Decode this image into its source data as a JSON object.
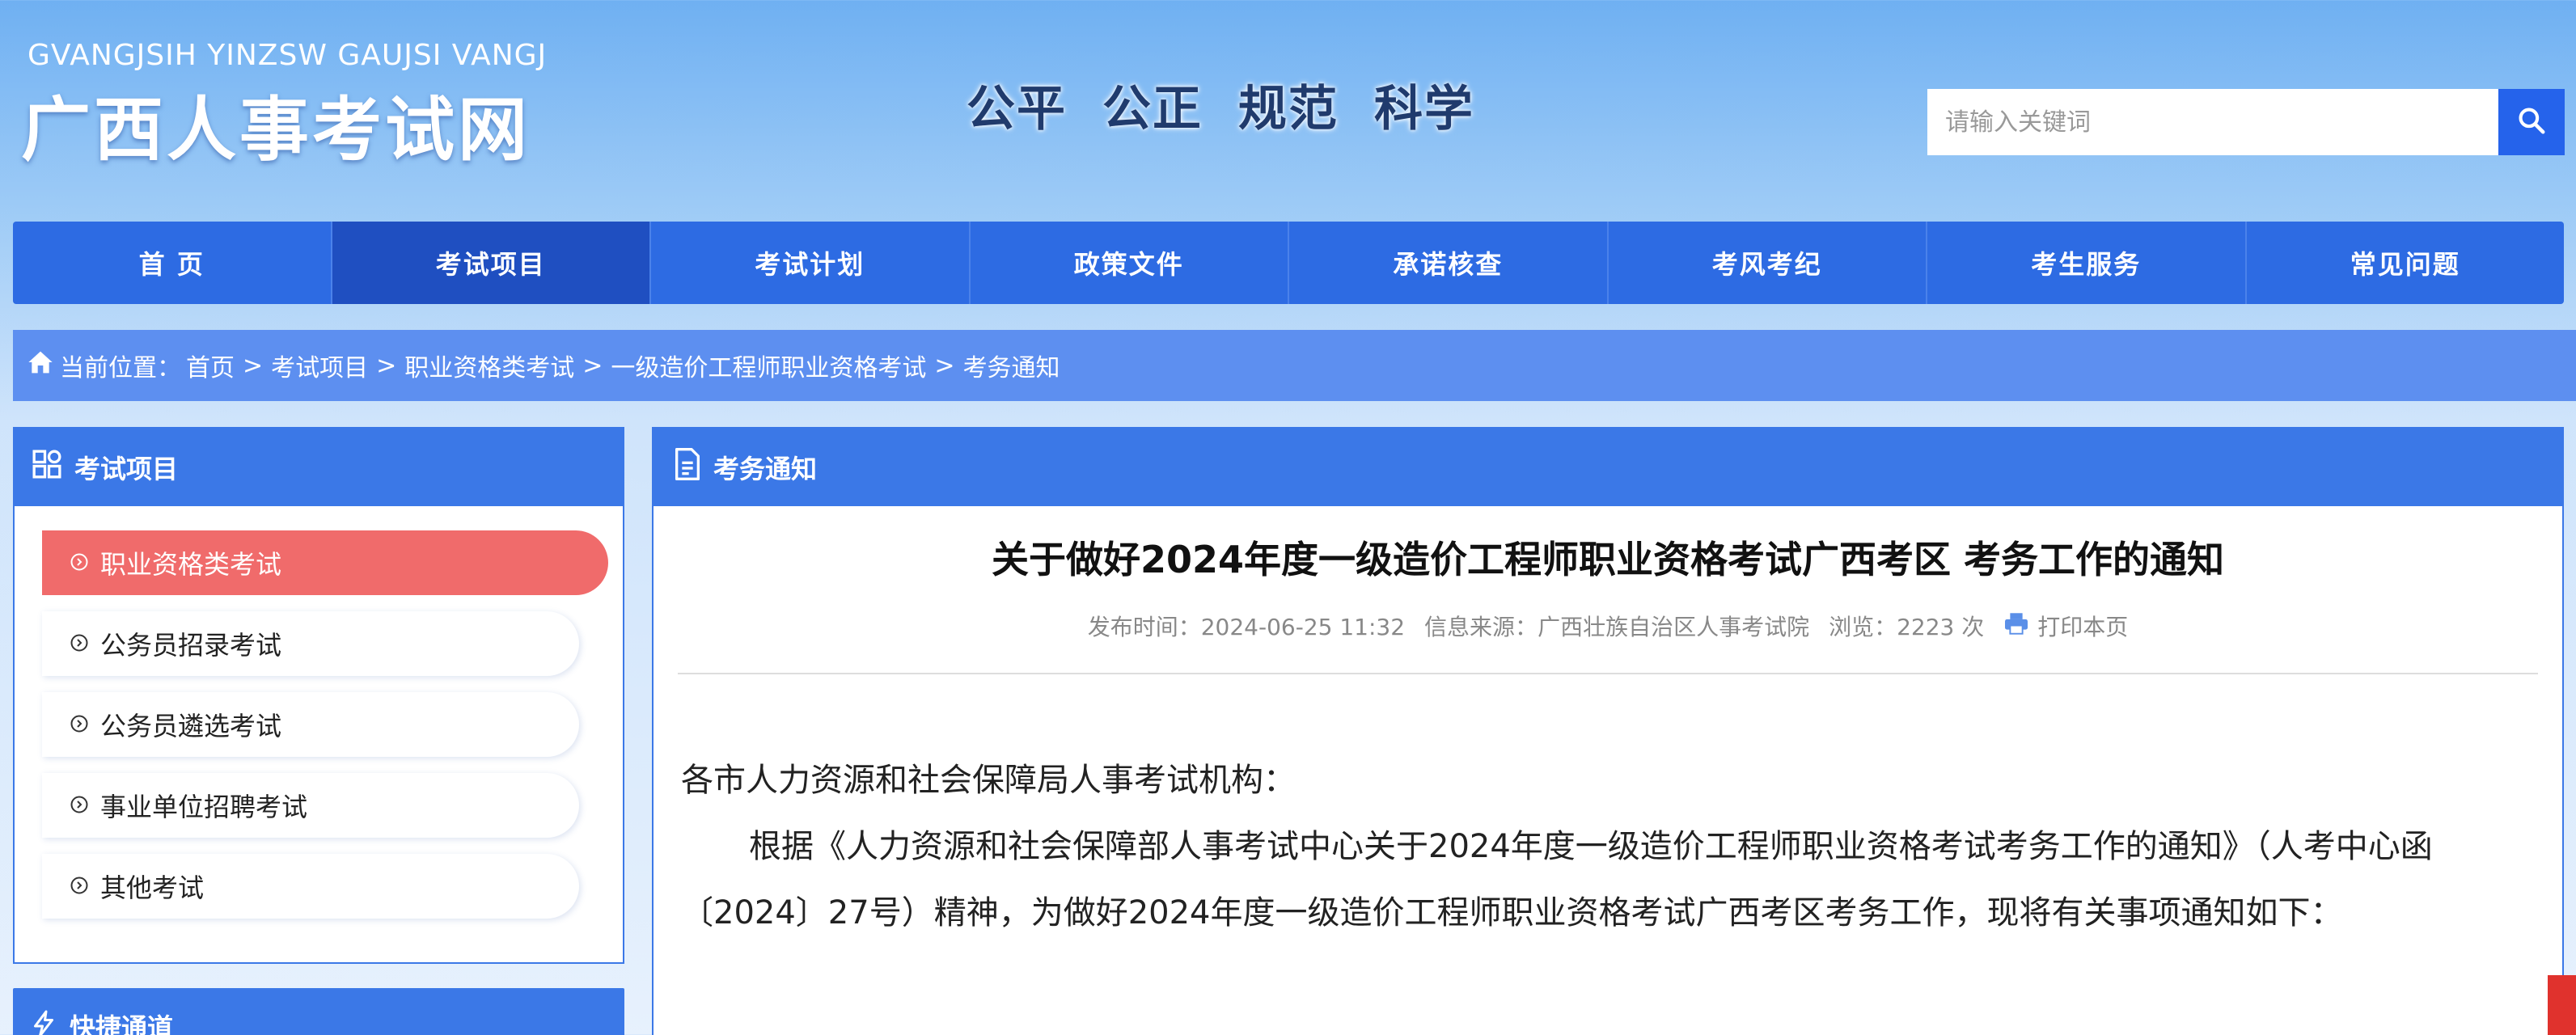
{
  "header": {
    "logo_en": "GVANGJSIH YINZSW GAUJSI VANGJ",
    "logo_cn": "广西人事考试网",
    "slogan": [
      "公平",
      "公正",
      "规范",
      "科学"
    ],
    "search": {
      "placeholder": "请输入关键词",
      "icon": "search-icon"
    }
  },
  "nav": {
    "items": [
      {
        "label": "首 页"
      },
      {
        "label": "考试项目",
        "active": true
      },
      {
        "label": "考试计划"
      },
      {
        "label": "政策文件"
      },
      {
        "label": "承诺核查"
      },
      {
        "label": "考风考纪"
      },
      {
        "label": "考生服务"
      },
      {
        "label": "常见问题"
      }
    ]
  },
  "breadcrumb": {
    "icon": "home-icon",
    "label": "当前位置：",
    "items": [
      "首页",
      "考试项目",
      "职业资格类考试",
      "一级造价工程师职业资格考试",
      "考务通知"
    ],
    "separator": ">"
  },
  "sidebar": {
    "title": "考试项目",
    "icon": "grid-icon",
    "items": [
      {
        "label": "职业资格类考试",
        "active": true
      },
      {
        "label": "公务员招录考试"
      },
      {
        "label": "公务员遴选考试"
      },
      {
        "label": "事业单位招聘考试"
      },
      {
        "label": "其他考试"
      }
    ],
    "second_title": "快捷通道"
  },
  "main": {
    "section_title": "考务通知",
    "section_icon": "document-icon",
    "article": {
      "title": "关于做好2024年度一级造价工程师职业资格考试广西考区 考务工作的通知",
      "publish_label": "发布时间：",
      "publish_time": "2024-06-25 11:32",
      "source_label": "信息来源：",
      "source": "广西壮族自治区人事考试院",
      "views_label": "浏览：",
      "views": "2223",
      "views_unit": "次",
      "print_label": "打印本页",
      "print_icon": "printer-icon",
      "salutation": "各市人力资源和社会保障局人事考试机构：",
      "paragraph_1": "根据《人力资源和社会保障部人事考试中心关于2024年度一级造价工程师职业资格考试考务工作的通知》（人考中心函〔2024〕27号）精神，为做好2024年度一级造价工程师职业资格考试广西考区考务工作，现将有关事项通知如下："
    }
  },
  "colors": {
    "nav_bg": "#2d6be3",
    "nav_active": "#1f4fc1",
    "breadcrumb_bg": "#5d8ff0",
    "panel_head": "#3b78e7",
    "sidebar_active": "#f06b6b",
    "search_btn": "#2563eb"
  }
}
